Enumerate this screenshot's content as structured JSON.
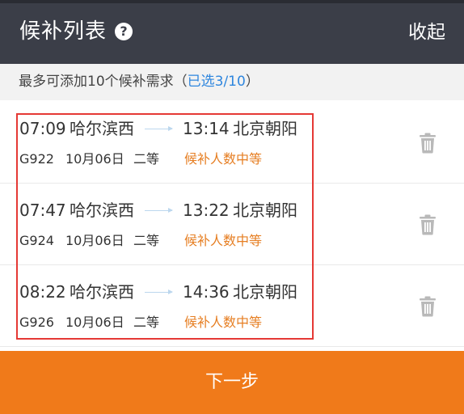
{
  "header": {
    "title": "候补列表",
    "help_icon": "question-circle-icon",
    "collapse_label": "收起"
  },
  "info_bar": {
    "text": "最多可添加10个候补需求（",
    "selected": "已选3/10",
    "close_paren": "）"
  },
  "items": [
    {
      "dep_time": "07:09",
      "dep_station": "哈尔滨西",
      "arr_time": "13:14",
      "arr_station": "北京朝阳",
      "train_no": "G922",
      "date": "10月06日",
      "seat": "二等",
      "status": "候补人数中等"
    },
    {
      "dep_time": "07:47",
      "dep_station": "哈尔滨西",
      "arr_time": "13:22",
      "arr_station": "北京朝阳",
      "train_no": "G924",
      "date": "10月06日",
      "seat": "二等",
      "status": "候补人数中等"
    },
    {
      "dep_time": "08:22",
      "dep_station": "哈尔滨西",
      "arr_time": "14:36",
      "arr_station": "北京朝阳",
      "train_no": "G926",
      "date": "10月06日",
      "seat": "二等",
      "status": "候补人数中等"
    }
  ],
  "footer": {
    "next_label": "下一步"
  },
  "colors": {
    "header_bg": "#3b3e48",
    "accent_orange": "#f07a1a",
    "status_orange": "#e67e22",
    "link_blue": "#2e86de",
    "highlight_red": "#e53935"
  },
  "icons": {
    "delete": "trash-icon",
    "arrow": "arrow-right-icon"
  }
}
